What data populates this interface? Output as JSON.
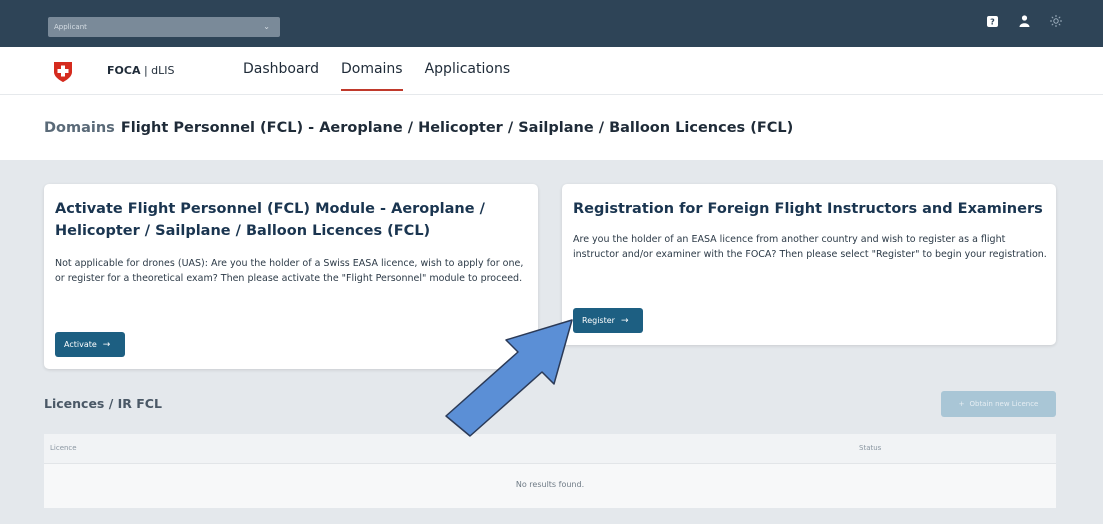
{
  "topbar": {
    "role_select": "Applicant",
    "icons": [
      "help-icon",
      "user-icon",
      "theme-sun-icon"
    ]
  },
  "header": {
    "brand_bold": "FOCA",
    "brand_rest": " | dLIS",
    "nav": [
      {
        "label": "Dashboard",
        "active": false
      },
      {
        "label": "Domains",
        "active": true
      },
      {
        "label": "Applications",
        "active": false
      }
    ]
  },
  "breadcrumb": {
    "parent": "Domains",
    "current": "Flight Personnel (FCL) - Aeroplane / Helicopter / Sailplane / Balloon Licences (FCL)"
  },
  "cards": [
    {
      "title": "Activate Flight Personnel (FCL) Module - Aeroplane / Helicopter / Sailplane / Balloon Licences (FCL)",
      "text": "Not applicable for drones (UAS): Are you the holder of a Swiss EASA licence, wish to apply for one, or register for a theoretical exam? Then please activate the \"Flight Personnel\" module to proceed.",
      "button": "Activate"
    },
    {
      "title": "Registration for Foreign Flight Instructors and Examiners",
      "text": "Are you the holder of an EASA licence from another country and wish to register as a flight instructor and/or examiner with the FOCA? Then please select \"Register\" to begin your registration.",
      "button": "Register"
    }
  ],
  "licences": {
    "title": "Licences / IR FCL",
    "obtain_button": "Obtain new Licence",
    "columns": [
      "Licence",
      "Status"
    ],
    "empty_text": "No results found."
  },
  "colors": {
    "topbar": "#2e4457",
    "primary_button": "#1d5f82",
    "active_underline": "#c0392b",
    "annotation_arrow": "#5b8fd6"
  }
}
